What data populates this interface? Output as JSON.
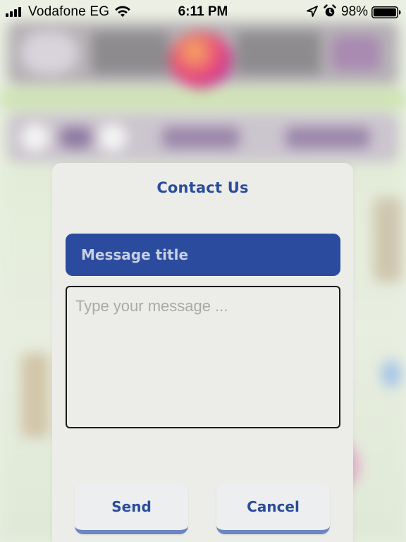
{
  "status_bar": {
    "carrier": "Vodafone EG",
    "time": "6:11 PM",
    "battery_percent": "98%",
    "icons": [
      "signal-icon",
      "wifi-icon",
      "location-icon",
      "alarm-icon",
      "battery-icon"
    ]
  },
  "modal": {
    "title": "Contact Us",
    "title_field": {
      "placeholder": "Message title",
      "value": ""
    },
    "message_field": {
      "placeholder": "Type your message ...",
      "value": ""
    },
    "buttons": {
      "send": "Send",
      "cancel": "Cancel"
    }
  },
  "colors": {
    "accent": "#2b4c9e",
    "button_border": "#6c86c2",
    "modal_bg": "#ecece8"
  }
}
